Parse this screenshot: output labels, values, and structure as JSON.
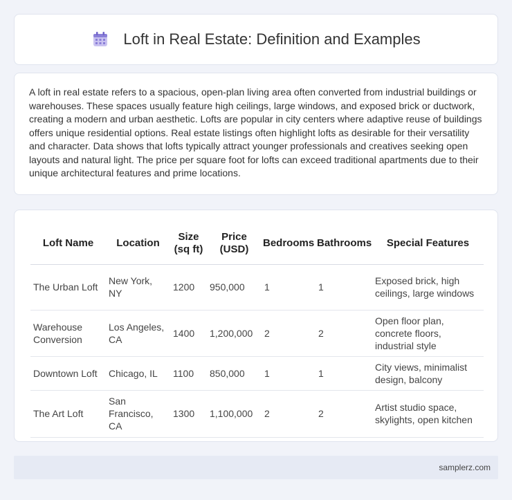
{
  "header": {
    "title": "Loft in Real Estate: Definition and Examples",
    "icon": "calendar-icon",
    "icon_color": "#8a7fd8"
  },
  "intro": {
    "text": "A loft in real estate refers to a spacious, open-plan living area often converted from industrial buildings or warehouses. These spaces usually feature high ceilings, large windows, and exposed brick or ductwork, creating a modern and urban aesthetic. Lofts are popular in city centers where adaptive reuse of buildings offers unique residential options. Real estate listings often highlight lofts as desirable for their versatility and character. Data shows that lofts typically attract younger professionals and creatives seeking open layouts and natural light. The price per square foot for lofts can exceed traditional apartments due to their unique architectural features and prime locations."
  },
  "table": {
    "headers": [
      "Loft Name",
      "Location",
      "Size (sq ft)",
      "Price (USD)",
      "Bedrooms",
      "Bathrooms",
      "Special Features"
    ],
    "rows": [
      [
        "The Urban Loft",
        "New York, NY",
        "1200",
        "950,000",
        "1",
        "1",
        "Exposed brick, high ceilings, large windows"
      ],
      [
        "Warehouse Conversion",
        "Los Angeles, CA",
        "1400",
        "1,200,000",
        "2",
        "2",
        "Open floor plan, concrete floors, industrial style"
      ],
      [
        "Downtown Loft",
        "Chicago, IL",
        "1100",
        "850,000",
        "1",
        "1",
        "City views, minimalist design, balcony"
      ],
      [
        "The Art Loft",
        "San Francisco, CA",
        "1300",
        "1,100,000",
        "2",
        "2",
        "Artist studio space, skylights, open kitchen"
      ]
    ]
  },
  "footer": {
    "text": "samplerz.com"
  }
}
